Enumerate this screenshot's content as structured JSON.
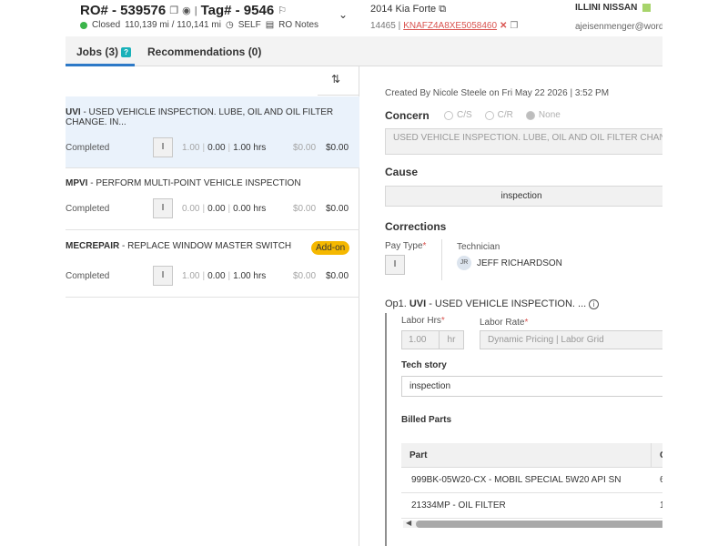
{
  "header": {
    "ro": "RO# - 539576",
    "tag": "Tag# - 9546",
    "status": "Closed",
    "mileage": "110,139 mi / 110,141 mi",
    "advisor": "SELF",
    "ro_notes": "RO Notes",
    "vehicle": "2014 Kia Forte",
    "vehicle_code": "14465 |",
    "vin": "KNAFZ4A8XE5058460",
    "dealer": "ILLINI NISSAN",
    "email": "ajeisenmenger@worde"
  },
  "tabs": {
    "jobs": "Jobs (3)",
    "jobs_badge": "?",
    "recommendations": "Recommendations (0)"
  },
  "jobs": [
    {
      "code": "UVI",
      "desc": " - USED VEHICLE INSPECTION. LUBE, OIL AND OIL FILTER CHANGE. IN...",
      "status": "Completed",
      "pay": "I",
      "hrs1": "1.00",
      "hrs2": "0.00",
      "hrs3": "1.00 hrs",
      "cost": "$0.00",
      "price": "$0.00"
    },
    {
      "code": "MPVI",
      "desc": " - PERFORM MULTI-POINT VEHICLE INSPECTION",
      "status": "Completed",
      "pay": "I",
      "hrs1": "0.00",
      "hrs2": "0.00",
      "hrs3": "0.00 hrs",
      "cost": "$0.00",
      "price": "$0.00"
    },
    {
      "code": "MECREPAIR",
      "desc": " - REPLACE WINDOW MASTER SWITCH",
      "badge": "Add-on",
      "status": "Completed",
      "pay": "I",
      "hrs1": "1.00",
      "hrs2": "0.00",
      "hrs3": "1.00 hrs",
      "cost": "$0.00",
      "price": "$0.00"
    }
  ],
  "detail": {
    "created": "Created By Nicole Steele on Fri May 22 2026 | 3:52 PM",
    "concern_label": "Concern",
    "concern_opts": [
      "C/S",
      "C/R",
      "None"
    ],
    "concern_text": "USED VEHICLE INSPECTION. LUBE, OIL AND OIL FILTER CHANGE.",
    "cause_label": "Cause",
    "cause_text": "inspection",
    "corrections_label": "Corrections",
    "pay_type_label": "Pay Type",
    "pay_type_value": "I",
    "technician_label": "Technician",
    "tech_initials": "JR",
    "tech_name": "JEFF RICHARDSON",
    "op_prefix": "Op1.",
    "op_code": "UVI",
    "op_desc": "- USED VEHICLE INSPECTION. ...",
    "labor_hrs_label": "Labor Hrs",
    "labor_hrs_value": "1.00",
    "labor_hrs_unit": "hr",
    "labor_rate_label": "Labor Rate",
    "labor_rate_value": "Dynamic Pricing | Labor Grid",
    "tech_story_label": "Tech story",
    "tech_story_value": "inspection",
    "billed_parts_label": "Billed Parts",
    "parts_col_part": "Part",
    "parts_col_qty": "Q",
    "parts": [
      {
        "name": "999BK-05W20-CX - MOBIL SPECIAL 5W20 API SN",
        "qty": "6"
      },
      {
        "name": "21334MP - OIL FILTER",
        "qty": "1"
      }
    ]
  },
  "colors": {
    "accent": "#2d79c7",
    "status_closed": "#3bb54a",
    "vin_red": "#d9534f",
    "addon": "#f5b800",
    "selected_row": "#eaf2fb"
  }
}
